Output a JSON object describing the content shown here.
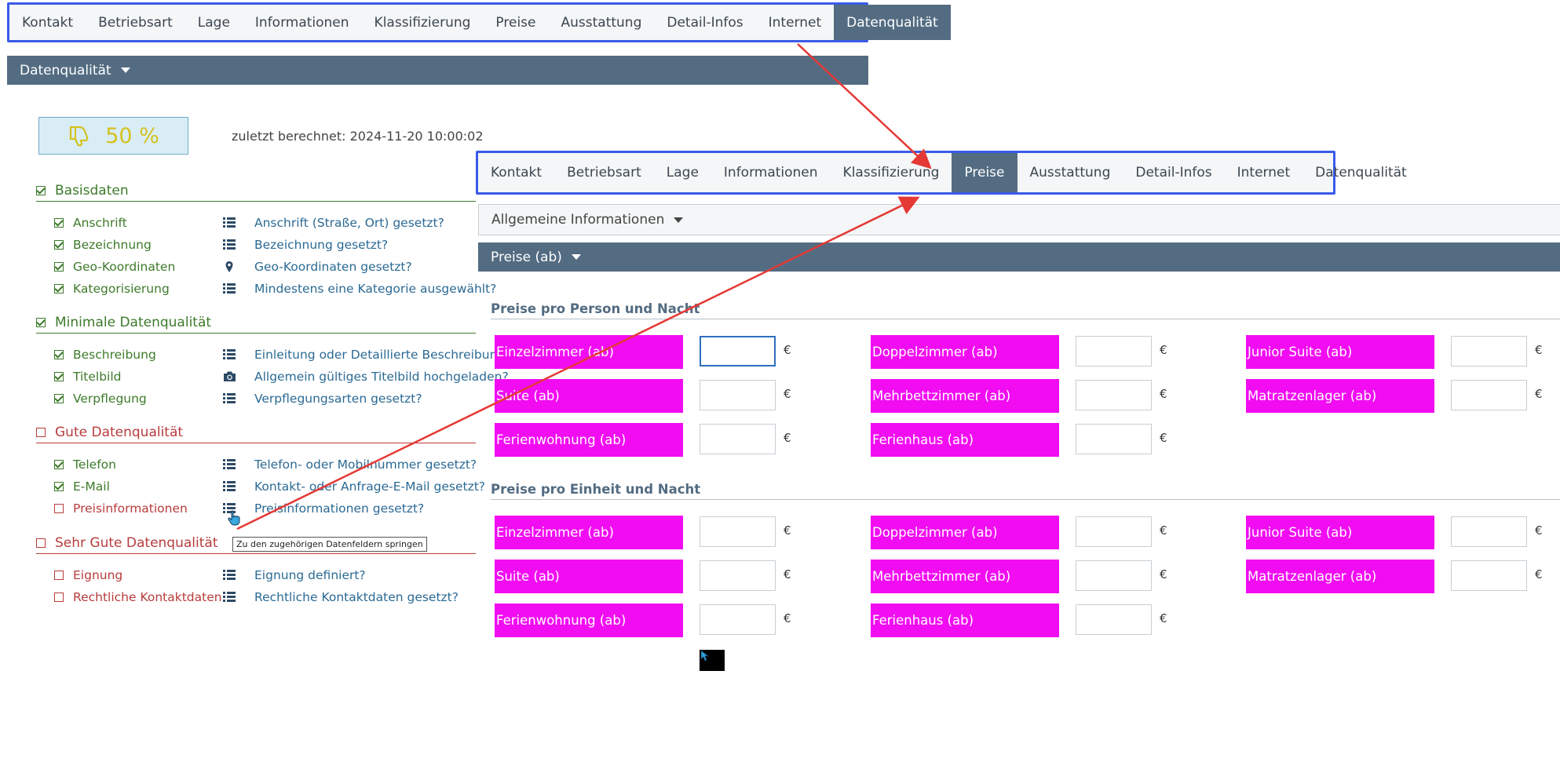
{
  "tabs_top": [
    "Kontakt",
    "Betriebsart",
    "Lage",
    "Informationen",
    "Klassifizierung",
    "Preise",
    "Ausstattung",
    "Detail-Infos",
    "Internet",
    "Datenqualität"
  ],
  "tabs_top_active": "Datenqualität",
  "tabs_overlay": [
    "Kontakt",
    "Betriebsart",
    "Lage",
    "Informationen",
    "Klassifizierung",
    "Preise",
    "Ausstattung",
    "Detail-Infos",
    "Internet",
    "Datenqualität"
  ],
  "tabs_overlay_active": "Preise",
  "quality_section": {
    "title": "Datenqualität"
  },
  "score": {
    "value": "50 %"
  },
  "last_calc": "zuletzt berechnet: 2024-11-20 10:00:02",
  "groups": [
    {
      "title": "Basisdaten",
      "status": "ok",
      "items": [
        {
          "label": "Anschrift",
          "icon": "list-icon",
          "link": "Anschrift (Straße, Ort) gesetzt?",
          "status": "ok"
        },
        {
          "label": "Bezeichnung",
          "icon": "list-icon",
          "link": "Bezeichnung gesetzt?",
          "status": "ok"
        },
        {
          "label": "Geo-Koordinaten",
          "icon": "map-pin-icon",
          "link": "Geo-Koordinaten gesetzt?",
          "status": "ok"
        },
        {
          "label": "Kategorisierung",
          "icon": "list-icon",
          "link": "Mindestens eine Kategorie ausgewählt?",
          "status": "ok"
        }
      ]
    },
    {
      "title": "Minimale Datenqualität",
      "status": "ok",
      "items": [
        {
          "label": "Beschreibung",
          "icon": "list-icon",
          "link": "Einleitung oder Detaillierte Beschreibung",
          "status": "ok"
        },
        {
          "label": "Titelbild",
          "icon": "camera-icon",
          "link": "Allgemein gültiges Titelbild hochgeladen?",
          "status": "ok"
        },
        {
          "label": "Verpflegung",
          "icon": "list-icon",
          "link": "Verpflegungsarten gesetzt?",
          "status": "ok"
        }
      ]
    },
    {
      "title": "Gute Datenqualität",
      "status": "bad",
      "items": [
        {
          "label": "Telefon",
          "icon": "list-icon",
          "link": "Telefon- oder Mobilnummer gesetzt?",
          "status": "ok"
        },
        {
          "label": "E-Mail",
          "icon": "list-icon",
          "link": "Kontakt- oder Anfrage-E-Mail gesetzt?",
          "status": "ok"
        },
        {
          "label": "Preisinformationen",
          "icon": "list-icon",
          "link": "Preisinformationen gesetzt?",
          "status": "bad"
        }
      ]
    },
    {
      "title": "Sehr Gute Datenqualität",
      "status": "bad",
      "items": [
        {
          "label": "Eignung",
          "icon": "list-icon",
          "link": "Eignung definiert?",
          "status": "bad"
        },
        {
          "label": "Rechtliche Kontaktdaten",
          "icon": "list-icon",
          "link": "Rechtliche Kontaktdaten gesetzt?",
          "status": "bad"
        }
      ]
    }
  ],
  "tooltip": "Zu den zugehörigen Datenfeldern springen",
  "allgemeine_section": {
    "title": "Allgemeine Informationen"
  },
  "preise_section": {
    "title": "Preise (ab)"
  },
  "currency": "€",
  "price_sections": [
    {
      "title": "Preise pro Person und Nacht",
      "fields": [
        "Einzelzimmer (ab)",
        "Doppelzimmer (ab)",
        "Junior Suite (ab)",
        "Suite (ab)",
        "Mehrbettzimmer (ab)",
        "Matratzenlager (ab)",
        "Ferienwohnung (ab)",
        "Ferienhaus (ab)"
      ]
    },
    {
      "title": "Preise pro Einheit und Nacht",
      "fields": [
        "Einzelzimmer (ab)",
        "Doppelzimmer (ab)",
        "Junior Suite (ab)",
        "Suite (ab)",
        "Mehrbettzimmer (ab)",
        "Matratzenlager (ab)",
        "Ferienwohnung (ab)",
        "Ferienhaus (ab)"
      ]
    }
  ],
  "colors": {
    "accent": "#536c82",
    "highlight": "#f20cf2",
    "ok": "#3d7a2a",
    "bad": "#b83c3c",
    "frame": "#3a5be8",
    "arrow": "#e53935",
    "score": "#d4c21c"
  }
}
